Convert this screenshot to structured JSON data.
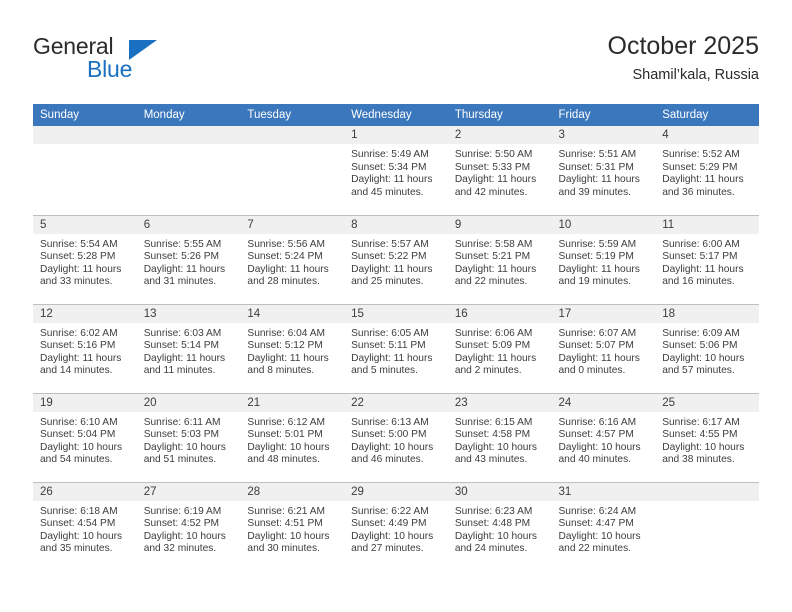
{
  "brand": {
    "word_one": "General",
    "word_two": "Blue",
    "triangle_color": "#1a70c0",
    "icon": "triangle-logo-icon"
  },
  "header": {
    "title": "October 2025",
    "subtitle": "Shamil’kala, Russia",
    "header_bg": "#3b77bd",
    "daynum_bg": "#f0f0f0"
  },
  "weekday_headers": [
    "Sunday",
    "Monday",
    "Tuesday",
    "Wednesday",
    "Thursday",
    "Friday",
    "Saturday"
  ],
  "labels": {
    "sunrise": "Sunrise:",
    "sunset": "Sunset:",
    "daylight": "Daylight:"
  },
  "weeks": [
    [
      {
        "day": "",
        "empty": true
      },
      {
        "day": "",
        "empty": true
      },
      {
        "day": "",
        "empty": true
      },
      {
        "day": "1",
        "sunrise": "Sunrise: 5:49 AM",
        "sunset": "Sunset: 5:34 PM",
        "daylight_line1": "Daylight: 11 hours",
        "daylight_line2": "and 45 minutes."
      },
      {
        "day": "2",
        "sunrise": "Sunrise: 5:50 AM",
        "sunset": "Sunset: 5:33 PM",
        "daylight_line1": "Daylight: 11 hours",
        "daylight_line2": "and 42 minutes."
      },
      {
        "day": "3",
        "sunrise": "Sunrise: 5:51 AM",
        "sunset": "Sunset: 5:31 PM",
        "daylight_line1": "Daylight: 11 hours",
        "daylight_line2": "and 39 minutes."
      },
      {
        "day": "4",
        "sunrise": "Sunrise: 5:52 AM",
        "sunset": "Sunset: 5:29 PM",
        "daylight_line1": "Daylight: 11 hours",
        "daylight_line2": "and 36 minutes."
      }
    ],
    [
      {
        "day": "5",
        "sunrise": "Sunrise: 5:54 AM",
        "sunset": "Sunset: 5:28 PM",
        "daylight_line1": "Daylight: 11 hours",
        "daylight_line2": "and 33 minutes."
      },
      {
        "day": "6",
        "sunrise": "Sunrise: 5:55 AM",
        "sunset": "Sunset: 5:26 PM",
        "daylight_line1": "Daylight: 11 hours",
        "daylight_line2": "and 31 minutes."
      },
      {
        "day": "7",
        "sunrise": "Sunrise: 5:56 AM",
        "sunset": "Sunset: 5:24 PM",
        "daylight_line1": "Daylight: 11 hours",
        "daylight_line2": "and 28 minutes."
      },
      {
        "day": "8",
        "sunrise": "Sunrise: 5:57 AM",
        "sunset": "Sunset: 5:22 PM",
        "daylight_line1": "Daylight: 11 hours",
        "daylight_line2": "and 25 minutes."
      },
      {
        "day": "9",
        "sunrise": "Sunrise: 5:58 AM",
        "sunset": "Sunset: 5:21 PM",
        "daylight_line1": "Daylight: 11 hours",
        "daylight_line2": "and 22 minutes."
      },
      {
        "day": "10",
        "sunrise": "Sunrise: 5:59 AM",
        "sunset": "Sunset: 5:19 PM",
        "daylight_line1": "Daylight: 11 hours",
        "daylight_line2": "and 19 minutes."
      },
      {
        "day": "11",
        "sunrise": "Sunrise: 6:00 AM",
        "sunset": "Sunset: 5:17 PM",
        "daylight_line1": "Daylight: 11 hours",
        "daylight_line2": "and 16 minutes."
      }
    ],
    [
      {
        "day": "12",
        "sunrise": "Sunrise: 6:02 AM",
        "sunset": "Sunset: 5:16 PM",
        "daylight_line1": "Daylight: 11 hours",
        "daylight_line2": "and 14 minutes."
      },
      {
        "day": "13",
        "sunrise": "Sunrise: 6:03 AM",
        "sunset": "Sunset: 5:14 PM",
        "daylight_line1": "Daylight: 11 hours",
        "daylight_line2": "and 11 minutes."
      },
      {
        "day": "14",
        "sunrise": "Sunrise: 6:04 AM",
        "sunset": "Sunset: 5:12 PM",
        "daylight_line1": "Daylight: 11 hours",
        "daylight_line2": "and 8 minutes."
      },
      {
        "day": "15",
        "sunrise": "Sunrise: 6:05 AM",
        "sunset": "Sunset: 5:11 PM",
        "daylight_line1": "Daylight: 11 hours",
        "daylight_line2": "and 5 minutes."
      },
      {
        "day": "16",
        "sunrise": "Sunrise: 6:06 AM",
        "sunset": "Sunset: 5:09 PM",
        "daylight_line1": "Daylight: 11 hours",
        "daylight_line2": "and 2 minutes."
      },
      {
        "day": "17",
        "sunrise": "Sunrise: 6:07 AM",
        "sunset": "Sunset: 5:07 PM",
        "daylight_line1": "Daylight: 11 hours",
        "daylight_line2": "and 0 minutes."
      },
      {
        "day": "18",
        "sunrise": "Sunrise: 6:09 AM",
        "sunset": "Sunset: 5:06 PM",
        "daylight_line1": "Daylight: 10 hours",
        "daylight_line2": "and 57 minutes."
      }
    ],
    [
      {
        "day": "19",
        "sunrise": "Sunrise: 6:10 AM",
        "sunset": "Sunset: 5:04 PM",
        "daylight_line1": "Daylight: 10 hours",
        "daylight_line2": "and 54 minutes."
      },
      {
        "day": "20",
        "sunrise": "Sunrise: 6:11 AM",
        "sunset": "Sunset: 5:03 PM",
        "daylight_line1": "Daylight: 10 hours",
        "daylight_line2": "and 51 minutes."
      },
      {
        "day": "21",
        "sunrise": "Sunrise: 6:12 AM",
        "sunset": "Sunset: 5:01 PM",
        "daylight_line1": "Daylight: 10 hours",
        "daylight_line2": "and 48 minutes."
      },
      {
        "day": "22",
        "sunrise": "Sunrise: 6:13 AM",
        "sunset": "Sunset: 5:00 PM",
        "daylight_line1": "Daylight: 10 hours",
        "daylight_line2": "and 46 minutes."
      },
      {
        "day": "23",
        "sunrise": "Sunrise: 6:15 AM",
        "sunset": "Sunset: 4:58 PM",
        "daylight_line1": "Daylight: 10 hours",
        "daylight_line2": "and 43 minutes."
      },
      {
        "day": "24",
        "sunrise": "Sunrise: 6:16 AM",
        "sunset": "Sunset: 4:57 PM",
        "daylight_line1": "Daylight: 10 hours",
        "daylight_line2": "and 40 minutes."
      },
      {
        "day": "25",
        "sunrise": "Sunrise: 6:17 AM",
        "sunset": "Sunset: 4:55 PM",
        "daylight_line1": "Daylight: 10 hours",
        "daylight_line2": "and 38 minutes."
      }
    ],
    [
      {
        "day": "26",
        "sunrise": "Sunrise: 6:18 AM",
        "sunset": "Sunset: 4:54 PM",
        "daylight_line1": "Daylight: 10 hours",
        "daylight_line2": "and 35 minutes."
      },
      {
        "day": "27",
        "sunrise": "Sunrise: 6:19 AM",
        "sunset": "Sunset: 4:52 PM",
        "daylight_line1": "Daylight: 10 hours",
        "daylight_line2": "and 32 minutes."
      },
      {
        "day": "28",
        "sunrise": "Sunrise: 6:21 AM",
        "sunset": "Sunset: 4:51 PM",
        "daylight_line1": "Daylight: 10 hours",
        "daylight_line2": "and 30 minutes."
      },
      {
        "day": "29",
        "sunrise": "Sunrise: 6:22 AM",
        "sunset": "Sunset: 4:49 PM",
        "daylight_line1": "Daylight: 10 hours",
        "daylight_line2": "and 27 minutes."
      },
      {
        "day": "30",
        "sunrise": "Sunrise: 6:23 AM",
        "sunset": "Sunset: 4:48 PM",
        "daylight_line1": "Daylight: 10 hours",
        "daylight_line2": "and 24 minutes."
      },
      {
        "day": "31",
        "sunrise": "Sunrise: 6:24 AM",
        "sunset": "Sunset: 4:47 PM",
        "daylight_line1": "Daylight: 10 hours",
        "daylight_line2": "and 22 minutes."
      },
      {
        "day": "",
        "empty": true
      }
    ]
  ]
}
